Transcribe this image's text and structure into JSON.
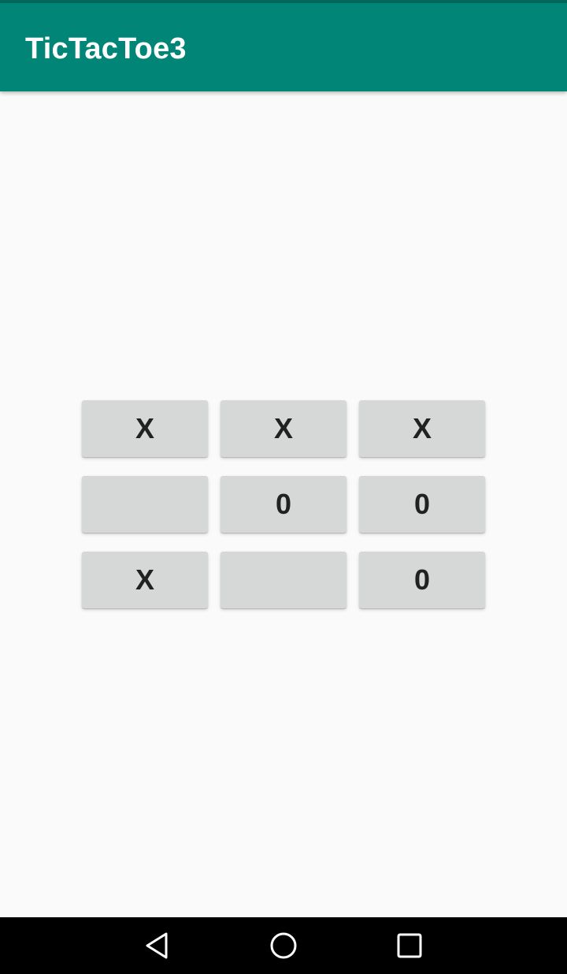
{
  "app": {
    "title": "TicTacToe3",
    "colors": {
      "status_bar": "#00695c",
      "app_bar": "#008577",
      "background": "#fafafa",
      "cell": "#d6d7d7",
      "cell_text": "#212121",
      "nav_bar": "#000000"
    }
  },
  "board": {
    "rows": [
      [
        "X",
        "X",
        "X"
      ],
      [
        "",
        "0",
        "0"
      ],
      [
        "X",
        "",
        "0"
      ]
    ]
  },
  "nav": {
    "back_icon": "back-triangle-icon",
    "home_icon": "home-circle-icon",
    "recents_icon": "recents-square-icon"
  }
}
